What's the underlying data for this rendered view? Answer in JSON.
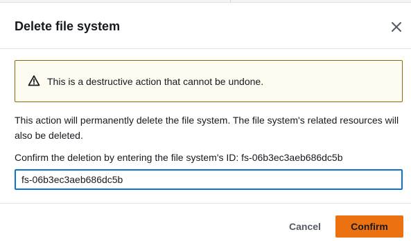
{
  "dialog": {
    "title": "Delete file system",
    "close_icon": "close-icon"
  },
  "warning": {
    "icon": "warning-triangle-icon",
    "text": "This is a destructive action that cannot be undone."
  },
  "description": "This action will permanently delete the file system. The file system's related resources will also be deleted.",
  "confirmation": {
    "label": "Confirm the deletion by entering the file system's ID: fs-06b3ec3aeb686dc5b",
    "input_value": "fs-06b3ec3aeb686dc5b"
  },
  "footer": {
    "cancel_label": "Cancel",
    "confirm_label": "Confirm"
  },
  "colors": {
    "primary_button": "#ec7211",
    "input_focus_border": "#0972d3",
    "warning_border": "#8d6605",
    "warning_background": "#fefbf0"
  }
}
